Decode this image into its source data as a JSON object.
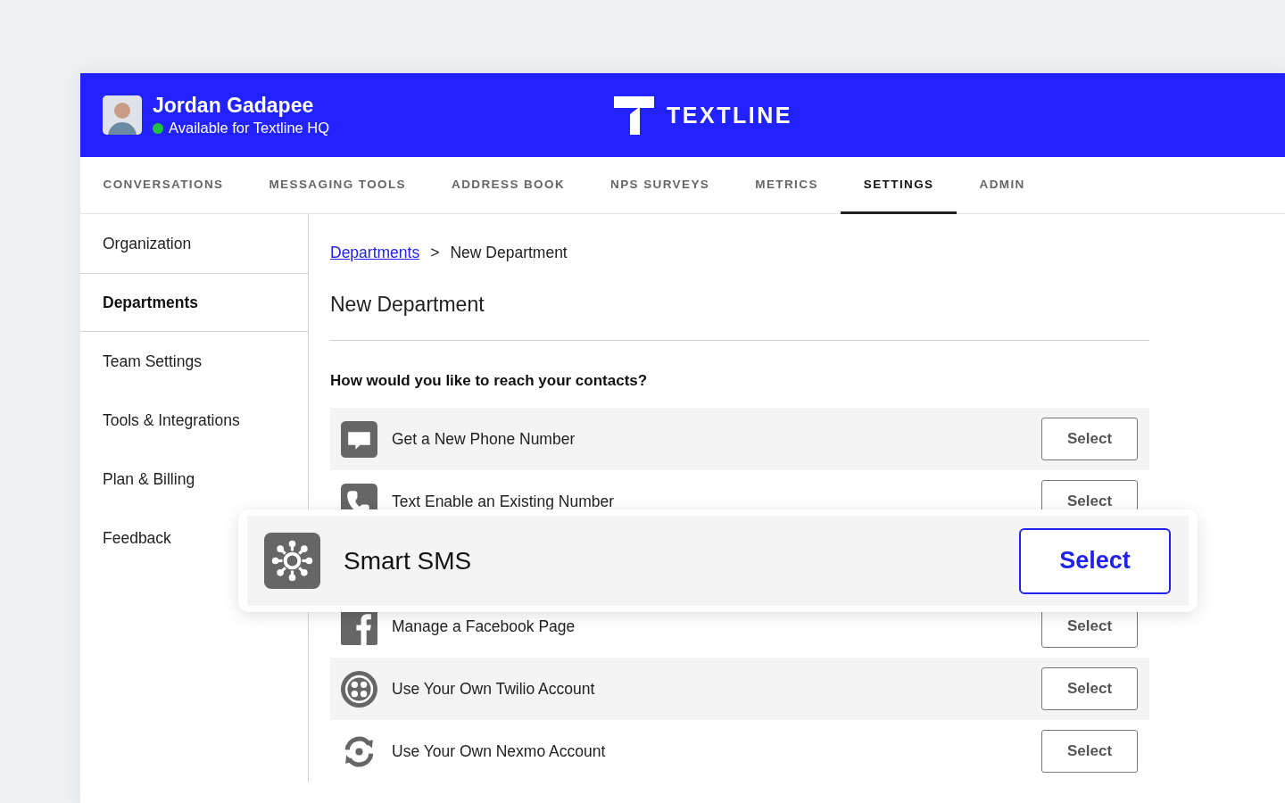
{
  "user": {
    "name": "Jordan Gadapee",
    "status": "Available for Textline HQ",
    "online": true
  },
  "logo": {
    "text": "TEXTLINE"
  },
  "tabs": [
    {
      "label": "CONVERSATIONS",
      "selected": false
    },
    {
      "label": "MESSAGING TOOLS",
      "selected": false
    },
    {
      "label": "ADDRESS BOOK",
      "selected": false
    },
    {
      "label": "NPS SURVEYS",
      "selected": false
    },
    {
      "label": "METRICS",
      "selected": false
    },
    {
      "label": "SETTINGS",
      "selected": true
    },
    {
      "label": "ADMIN",
      "selected": false
    }
  ],
  "sidebar": {
    "items": [
      {
        "label": "Organization",
        "selected": false
      },
      {
        "label": "Departments",
        "selected": true
      },
      {
        "label": "Team Settings",
        "selected": false
      },
      {
        "label": "Tools & Integrations",
        "selected": false
      },
      {
        "label": "Plan & Billing",
        "selected": false
      },
      {
        "label": "Feedback",
        "selected": false
      }
    ]
  },
  "breadcrumb": {
    "link": "Departments",
    "separator": ">",
    "current": "New Department"
  },
  "page_title": "New Department",
  "question": "How would you like to reach your contacts?",
  "options": [
    {
      "kind": "message",
      "label": "Get a New Phone Number",
      "button": "Select",
      "highlighted": false
    },
    {
      "kind": "phone",
      "label": "Text Enable an Existing Number",
      "button": "Select",
      "highlighted": false
    },
    {
      "kind": "network",
      "label": "Smart SMS",
      "button": "Select",
      "highlighted": true
    },
    {
      "kind": "facebook",
      "label": "Manage a Facebook Page",
      "button": "Select",
      "highlighted": false
    },
    {
      "kind": "twilio",
      "label": "Use Your Own Twilio Account",
      "button": "Select",
      "highlighted": false
    },
    {
      "kind": "nexmo",
      "label": "Use Your Own Nexmo Account",
      "button": "Select",
      "highlighted": false
    }
  ]
}
